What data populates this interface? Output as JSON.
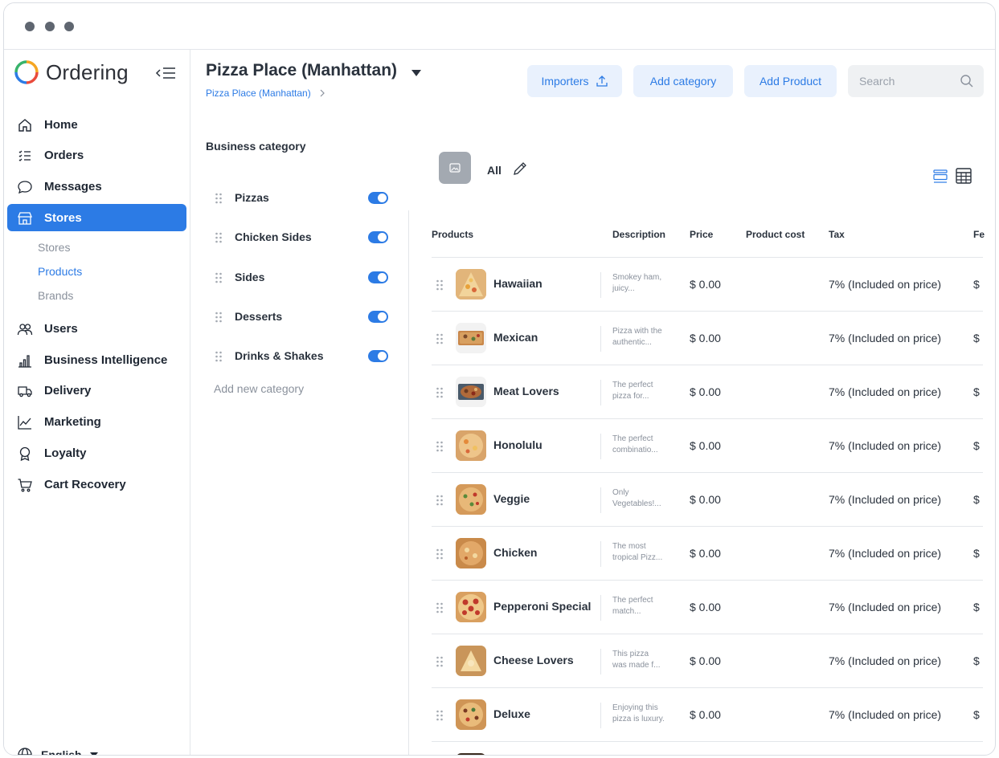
{
  "app": {
    "name": "Ordering"
  },
  "sidebar": {
    "items": [
      {
        "label": "Home",
        "icon": "home-icon"
      },
      {
        "label": "Orders",
        "icon": "orders-list-icon"
      },
      {
        "label": "Messages",
        "icon": "chat-bubble-icon"
      },
      {
        "label": "Stores",
        "icon": "storefront-icon",
        "active": true
      },
      {
        "label": "Users",
        "icon": "users-icon"
      },
      {
        "label": "Business Intelligence",
        "icon": "bar-chart-icon"
      },
      {
        "label": "Delivery",
        "icon": "truck-icon"
      },
      {
        "label": "Marketing",
        "icon": "line-chart-icon"
      },
      {
        "label": "Loyalty",
        "icon": "award-icon"
      },
      {
        "label": "Cart Recovery",
        "icon": "cart-icon"
      }
    ],
    "stores_sub": [
      "Stores",
      "Products",
      "Brands"
    ],
    "active_sub": "Products",
    "language": "English"
  },
  "header": {
    "title": "Pizza Place (Manhattan)",
    "breadcrumb": "Pizza Place (Manhattan)",
    "importers_label": "Importers",
    "add_category_label": "Add category",
    "add_product_label": "Add Product",
    "search_placeholder": "Search"
  },
  "categories": {
    "heading": "Business category",
    "items": [
      {
        "label": "Pizzas",
        "enabled": true
      },
      {
        "label": "Chicken Sides",
        "enabled": true
      },
      {
        "label": "Sides",
        "enabled": true
      },
      {
        "label": "Desserts",
        "enabled": true
      },
      {
        "label": "Drinks & Shakes",
        "enabled": true
      }
    ],
    "add_label": "Add new category"
  },
  "products": {
    "filter_label": "All",
    "columns": [
      "Products",
      "Description",
      "Price",
      "Product cost",
      "Tax",
      "Fe"
    ],
    "rows": [
      {
        "name": "Hawaiian",
        "desc1": "Smokey ham,",
        "desc2": "juicy...",
        "price": "$ 0.00",
        "tax": "7% (Included on price)",
        "fee": "$"
      },
      {
        "name": "Mexican",
        "desc1": "Pizza with the",
        "desc2": "authentic...",
        "price": "$ 0.00",
        "tax": "7% (Included on price)",
        "fee": "$"
      },
      {
        "name": "Meat Lovers",
        "desc1": "The perfect",
        "desc2": "pizza for...",
        "price": "$ 0.00",
        "tax": "7% (Included on price)",
        "fee": "$"
      },
      {
        "name": "Honolulu",
        "desc1": "The perfect",
        "desc2": "combinatio...",
        "price": "$ 0.00",
        "tax": "7% (Included on price)",
        "fee": "$"
      },
      {
        "name": "Veggie",
        "desc1": "Only",
        "desc2": "Vegetables!...",
        "price": "$ 0.00",
        "tax": "7% (Included on price)",
        "fee": "$"
      },
      {
        "name": "Chicken",
        "desc1": "The most",
        "desc2": "tropical Pizz...",
        "price": "$ 0.00",
        "tax": "7% (Included on price)",
        "fee": "$"
      },
      {
        "name": "Pepperoni Special",
        "desc1": "The perfect",
        "desc2": "match...",
        "price": "$ 0.00",
        "tax": "7% (Included on price)",
        "fee": "$"
      },
      {
        "name": "Cheese Lovers",
        "desc1": "This pizza",
        "desc2": "was made f...",
        "price": "$ 0.00",
        "tax": "7% (Included on price)",
        "fee": "$"
      },
      {
        "name": "Deluxe",
        "desc1": "Enjoying this",
        "desc2": "pizza is luxury.",
        "price": "$ 0.00",
        "tax": "7% (Included on price)",
        "fee": "$"
      }
    ]
  },
  "colors": {
    "accent": "#2c7be5",
    "accent_light": "#e9f1fd",
    "text": "#2a323d",
    "muted": "#8a919c"
  }
}
